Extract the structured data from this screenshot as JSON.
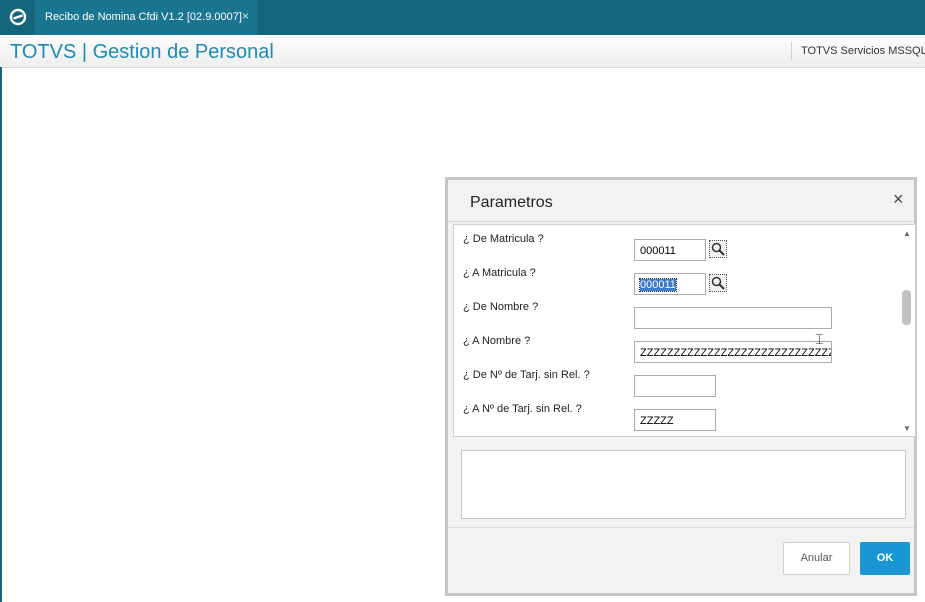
{
  "window": {
    "tab_title": "Recibo de Nomina Cfdi V1.2 [02.9.0007]",
    "tab_close": "×"
  },
  "header": {
    "app_title": "TOTVS | Gestion de Personal",
    "server": "TOTVS Servicios MSSQL"
  },
  "dialog": {
    "title": "Parametros",
    "close": "×",
    "params": [
      {
        "label": "¿ De Matricula ?",
        "value": "000011"
      },
      {
        "label": "¿ A Matricula ?",
        "value": "000011"
      },
      {
        "label": "¿ De Nombre ?",
        "value": ""
      },
      {
        "label": "¿ A Nombre ?",
        "value": "ZZZZZZZZZZZZZZZZZZZZZZZZZZZZZ"
      },
      {
        "label": "¿ De Nº de Tarj. sin Rel. ?",
        "value": ""
      },
      {
        "label": "¿ A Nº de Tarj. sin Rel. ?",
        "value": "ZZZZZ"
      }
    ],
    "scroll_up": "▲",
    "scroll_down": "▼",
    "cancel_label": "Anular",
    "ok_label": "OK"
  },
  "colors": {
    "topbar": "#15667d",
    "accent": "#1d8bb3",
    "ok_button": "#1a96d2"
  },
  "icons": {
    "logo": "totvs-logo-icon",
    "lookup": "search-icon",
    "cursor": "text-cursor-icon"
  }
}
